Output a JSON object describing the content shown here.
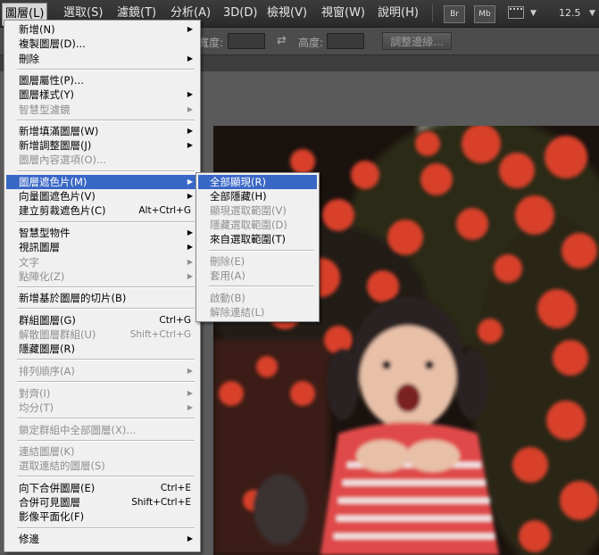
{
  "menubar": {
    "items": [
      {
        "label": "圖層(L)",
        "active": true
      },
      {
        "label": "選取(S)"
      },
      {
        "label": "濾鏡(T)"
      },
      {
        "label": "分析(A)"
      },
      {
        "label": "3D(D)"
      },
      {
        "label": "檢視(V)"
      },
      {
        "label": "視窗(W)"
      },
      {
        "label": "說明(H)"
      }
    ],
    "badges": [
      "Br",
      "Mb"
    ],
    "zoom": "12.5"
  },
  "options": {
    "width_label": "寬度:",
    "height_label": "高度:",
    "refine_edge_button": "調整邊緣..."
  },
  "main_menu": {
    "items": [
      {
        "label": "新增(N)",
        "submenu": true
      },
      {
        "label": "複製圖層(D)..."
      },
      {
        "label": "刪除",
        "submenu": true
      },
      {
        "label": "圖層屬性(P)..."
      },
      {
        "label": "圖層樣式(Y)",
        "submenu": true
      },
      {
        "label": "智慧型濾鏡",
        "submenu": true,
        "disabled": true
      },
      {
        "label": "新增填滿圖層(W)",
        "submenu": true
      },
      {
        "label": "新增調整圖層(J)",
        "submenu": true
      },
      {
        "label": "圖層內容選項(O)...",
        "disabled": true
      },
      {
        "label": "圖層遮色片(M)",
        "submenu": true,
        "highlighted": true
      },
      {
        "label": "向量圖遮色片(V)",
        "submenu": true
      },
      {
        "label": "建立剪裁遮色片(C)",
        "shortcut": "Alt+Ctrl+G"
      },
      {
        "label": "智慧型物件",
        "submenu": true
      },
      {
        "label": "視訊圖層",
        "submenu": true
      },
      {
        "label": "文字",
        "submenu": true,
        "disabled": true
      },
      {
        "label": "點陣化(Z)",
        "submenu": true,
        "disabled": true
      },
      {
        "label": "新增基於圖層的切片(B)"
      },
      {
        "label": "群組圖層(G)",
        "shortcut": "Ctrl+G"
      },
      {
        "label": "解散圖層群組(U)",
        "shortcut": "Shift+Ctrl+G",
        "disabled": true
      },
      {
        "label": "隱藏圖層(R)"
      },
      {
        "label": "排列順序(A)",
        "submenu": true,
        "disabled": true
      },
      {
        "label": "對齊(I)",
        "submenu": true,
        "disabled": true
      },
      {
        "label": "均分(T)",
        "submenu": true,
        "disabled": true
      },
      {
        "label": "鎖定群組中全部圖層(X)...",
        "disabled": true
      },
      {
        "label": "連結圖層(K)",
        "disabled": true
      },
      {
        "label": "選取連結的圖層(S)",
        "disabled": true
      },
      {
        "label": "向下合併圖層(E)",
        "shortcut": "Ctrl+E"
      },
      {
        "label": "合併可見圖層",
        "shortcut": "Shift+Ctrl+E"
      },
      {
        "label": "影像平面化(F)"
      },
      {
        "label": "修邊",
        "submenu": true
      }
    ]
  },
  "sub_menu": {
    "items": [
      {
        "label": "全部顯現(R)",
        "highlighted": true
      },
      {
        "label": "全部隱藏(H)"
      },
      {
        "label": "顯現選取範圍(V)",
        "disabled": true
      },
      {
        "label": "隱藏選取範圍(D)",
        "disabled": true
      },
      {
        "label": "來自選取範圍(T)"
      },
      {
        "label": "刪除(E)",
        "disabled": true
      },
      {
        "label": "套用(A)",
        "disabled": true
      },
      {
        "label": "啟動(B)",
        "disabled": true
      },
      {
        "label": "解除連結(L)",
        "disabled": true
      }
    ]
  },
  "colors": {
    "menu_highlight": "#3967c6",
    "menubar_bg": "#333333",
    "menu_bg": "#f0f0f0"
  }
}
